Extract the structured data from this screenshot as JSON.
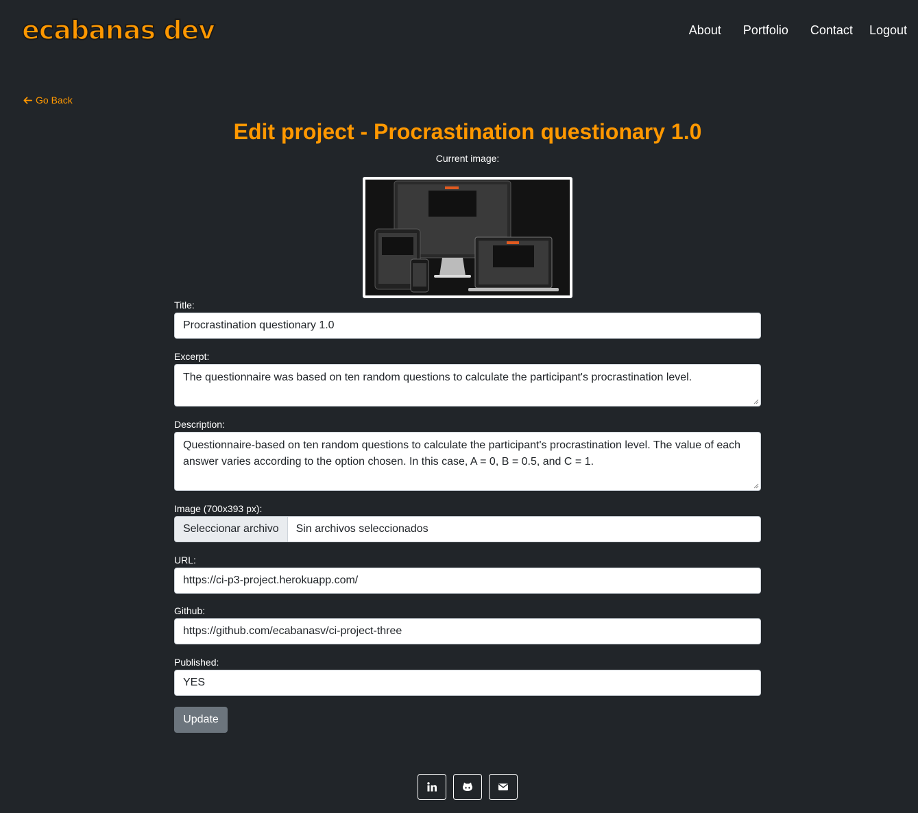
{
  "brand": {
    "logo_text": "ecabanas dev",
    "accent": "#ff9800"
  },
  "nav": {
    "about": "About",
    "portfolio": "Portfolio",
    "contact": "Contact",
    "logout": "Logout"
  },
  "back_link": {
    "label": "Go Back",
    "icon": "arrow-left-icon"
  },
  "page": {
    "title": "Edit project - Procrastination questionary 1.0",
    "current_image_label": "Current image:"
  },
  "form": {
    "title": {
      "label": "Title:",
      "value": "Procrastination questionary 1.0"
    },
    "excerpt": {
      "label": "Excerpt:",
      "value": "The questionnaire was based on ten random questions to calculate the participant's procrastination level."
    },
    "description": {
      "label": "Description:",
      "value": "Questionnaire-based on ten random questions to calculate the participant's procrastination level. The value of each answer varies according to the option chosen. In this case, A = 0, B = 0.5, and C = 1."
    },
    "image": {
      "label": "Image (700x393 px):",
      "button": "Seleccionar archivo",
      "status": "Sin archivos seleccionados"
    },
    "url": {
      "label": "URL:",
      "value": "https://ci-p3-project.herokuapp.com/"
    },
    "github": {
      "label": "Github:",
      "value": "https://github.com/ecabanasv/ci-project-three"
    },
    "published": {
      "label": "Published:",
      "value": "YES"
    },
    "submit": "Update"
  },
  "footer": {
    "icons": [
      "linkedin-icon",
      "github-icon",
      "envelope-icon"
    ]
  }
}
